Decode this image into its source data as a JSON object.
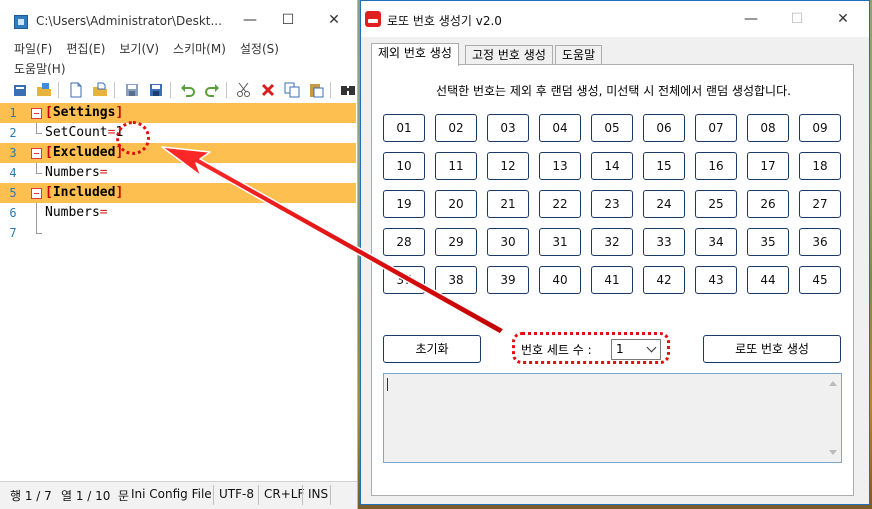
{
  "editor": {
    "title": "C:\\Users\\Administrator\\Deskt...",
    "menu": [
      "파일(F)",
      "편집(E)",
      "보기(V)",
      "스키마(M)",
      "설정(S)",
      "도움말(H)"
    ],
    "toolbar_icons": [
      "new-file-icon",
      "open-folder-icon",
      "new-doc-icon",
      "open-doc-icon",
      "save-icon",
      "save-as-icon",
      "undo-icon",
      "redo-icon",
      "cut-icon",
      "delete-icon",
      "copy-icon",
      "paste-icon",
      "find-icon"
    ],
    "lines": [
      {
        "no": "1",
        "text": "Settings",
        "section": true
      },
      {
        "no": "2",
        "key": "SetCount",
        "eq": "=",
        "val": "1"
      },
      {
        "no": "3",
        "text": "Excluded",
        "section": true
      },
      {
        "no": "4",
        "key": "Numbers",
        "eq": "=",
        "val": ""
      },
      {
        "no": "5",
        "text": "Included",
        "section": true
      },
      {
        "no": "6",
        "key": "Numbers",
        "eq": "=",
        "val": ""
      },
      {
        "no": "7",
        "key": "",
        "eq": "",
        "val": ""
      }
    ],
    "status": {
      "line": "행 1 / 7",
      "col": "열 1 / 10",
      "mode_cut": "문",
      "filetype": "Ini Config File",
      "encoding": "UTF-8",
      "eol": "CR+LF",
      "ins": "INS"
    }
  },
  "lotto": {
    "title": "로또 번호 생성기 v2.0",
    "tabs": [
      "제외 번호 생성",
      "고정 번호 생성",
      "도움말"
    ],
    "description": "선택한 번호는 제외 후 랜덤 생성, 미선택 시 전체에서 랜덤 생성합니다.",
    "numbers": [
      "01",
      "02",
      "03",
      "04",
      "05",
      "06",
      "07",
      "08",
      "09",
      "10",
      "11",
      "12",
      "13",
      "14",
      "15",
      "16",
      "17",
      "18",
      "19",
      "20",
      "21",
      "22",
      "23",
      "24",
      "25",
      "26",
      "27",
      "28",
      "29",
      "30",
      "31",
      "32",
      "33",
      "34",
      "35",
      "36",
      "37",
      "38",
      "39",
      "40",
      "41",
      "42",
      "43",
      "44",
      "45"
    ],
    "reset_label": "초기화",
    "setcount_label": "번호 세트 수 :",
    "setcount_value": "1",
    "generate_label": "로또 번호 생성",
    "output_text": ""
  },
  "colors": {
    "highlight": "#fdbf4f",
    "annotation": "#e01010",
    "button_border": "#1b3a66"
  }
}
